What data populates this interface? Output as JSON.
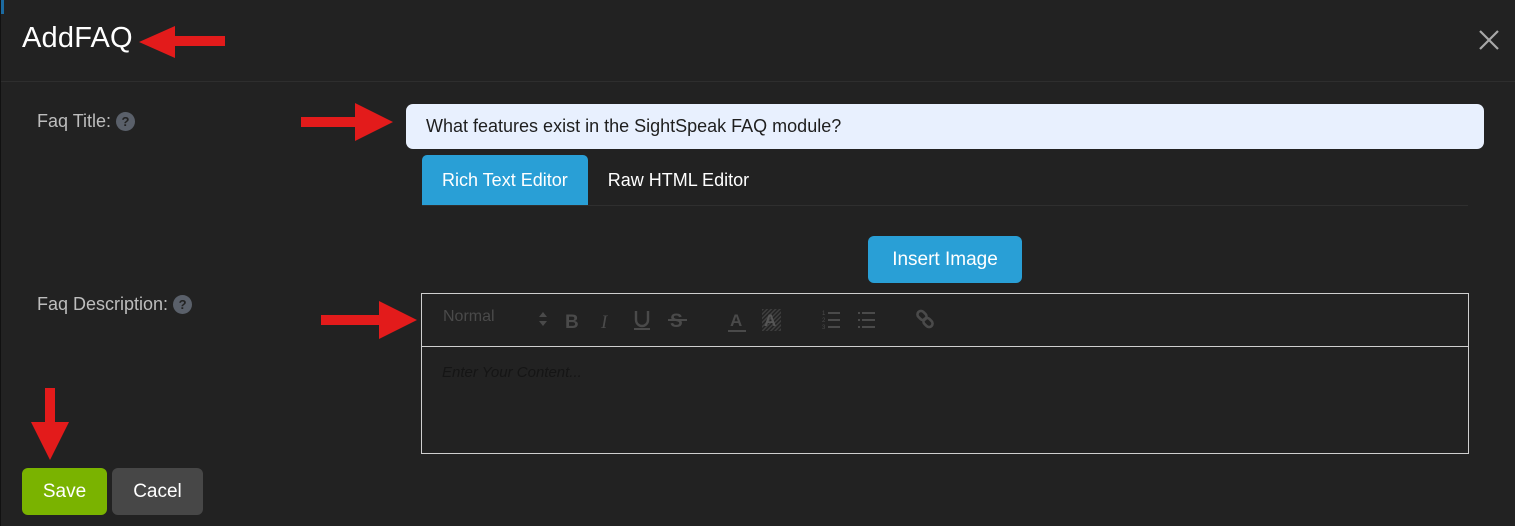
{
  "modal": {
    "title": "AddFAQ"
  },
  "form": {
    "faq_title_label": "Faq Title:",
    "faq_title_value": "What features exist in the SightSpeak FAQ module?",
    "faq_description_label": "Faq Description:",
    "help_glyph": "?"
  },
  "editor_tabs": [
    {
      "label": "Rich Text Editor",
      "active": true
    },
    {
      "label": "Raw HTML Editor",
      "active": false
    }
  ],
  "insert_image_label": "Insert Image",
  "editor": {
    "format_select_value": "Normal",
    "toolbar_icons": [
      "format-select-arrows-icon",
      "bold-icon",
      "italic-icon",
      "underline-icon",
      "strikethrough-icon",
      "text-color-icon",
      "background-color-icon",
      "ordered-list-icon",
      "bullet-list-icon",
      "link-icon"
    ],
    "placeholder": "Enter Your Content..."
  },
  "footer": {
    "save_label": "Save",
    "cancel_label": "Cacel"
  },
  "colors": {
    "accent_blue": "#299fd6",
    "save_green": "#7ab300",
    "cancel_gray": "#474747",
    "annotation_red": "#e31b1b"
  }
}
